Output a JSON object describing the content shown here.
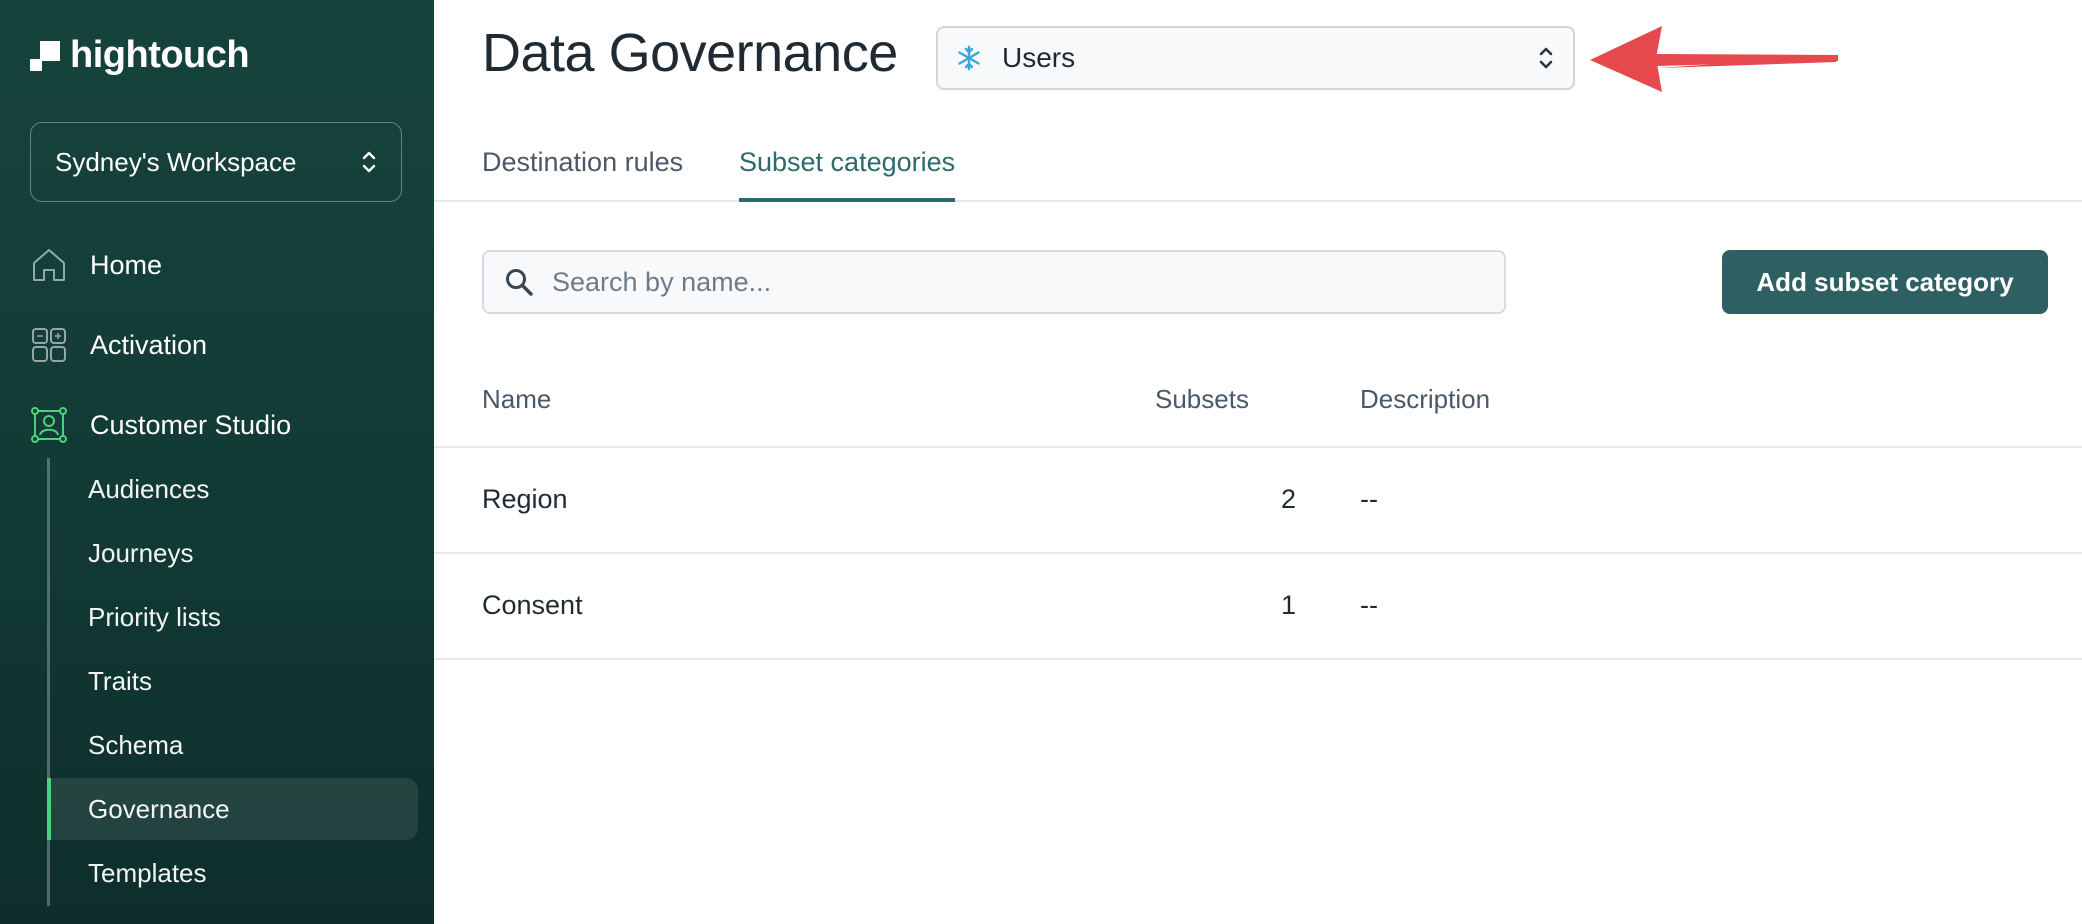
{
  "brand": {
    "name": "hightouch"
  },
  "workspace": {
    "label": "Sydney's Workspace"
  },
  "nav": {
    "items": [
      {
        "label": "Home",
        "icon": "home-icon"
      },
      {
        "label": "Activation",
        "icon": "grid-icon"
      },
      {
        "label": "Customer Studio",
        "icon": "person-frame-icon"
      }
    ],
    "sub_items": [
      {
        "label": "Audiences"
      },
      {
        "label": "Journeys"
      },
      {
        "label": "Priority lists"
      },
      {
        "label": "Traits"
      },
      {
        "label": "Schema"
      },
      {
        "label": "Governance",
        "active": true
      },
      {
        "label": "Templates"
      }
    ]
  },
  "page": {
    "title": "Data Governance",
    "model_select": {
      "value": "Users",
      "icon": "snowflake-icon"
    }
  },
  "tabs": [
    {
      "label": "Destination rules",
      "active": false
    },
    {
      "label": "Subset categories",
      "active": true
    }
  ],
  "search": {
    "placeholder": "Search by name...",
    "value": ""
  },
  "actions": {
    "add_label": "Add subset category"
  },
  "table": {
    "headers": {
      "name": "Name",
      "subsets": "Subsets",
      "description": "Description"
    },
    "rows": [
      {
        "name": "Region",
        "subsets": "2",
        "description": "--"
      },
      {
        "name": "Consent",
        "subsets": "1",
        "description": "--"
      }
    ]
  },
  "colors": {
    "sidebar_bg": "#17433d",
    "accent": "#2c6a6d",
    "active_indicator": "#4ed17a",
    "button_bg": "#2e5f63",
    "annotation_arrow": "#e5484d"
  }
}
